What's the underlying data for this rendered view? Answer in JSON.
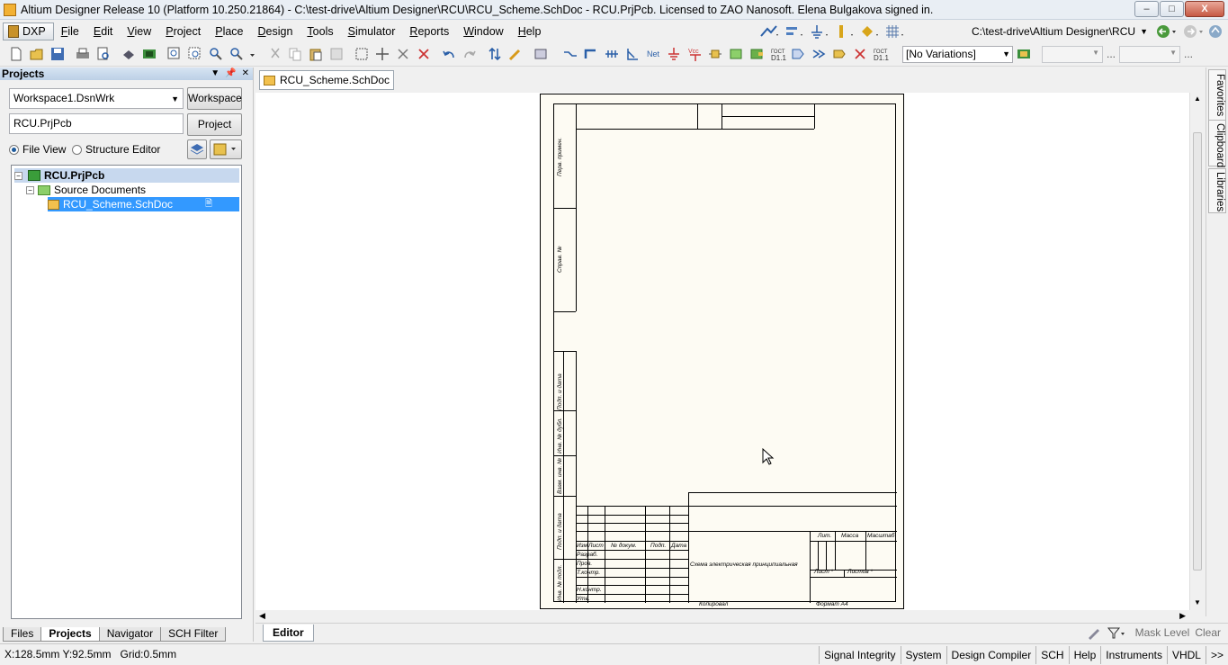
{
  "window": {
    "title": "Altium Designer Release 10 (Platform 10.250.21864) - C:\\test-drive\\Altium Designer\\RCU\\RCU_Scheme.SchDoc - RCU.PrjPcb. Licensed to ZAO Nanosoft. Elena Bulgakova signed in.",
    "minimize": "–",
    "maximize": "□",
    "close": "X"
  },
  "menu": {
    "dxp": "DXP",
    "items": [
      "File",
      "Edit",
      "View",
      "Project",
      "Place",
      "Design",
      "Tools",
      "Simulator",
      "Reports",
      "Window",
      "Help"
    ],
    "path": "C:\\test-drive\\Altium Designer\\RCU"
  },
  "toolbar": {
    "variations": "[No Variations]",
    "ellipsis1": "...",
    "ellipsis2": "..."
  },
  "projects_panel": {
    "title": "Projects",
    "workspace_value": "Workspace1.DsnWrk",
    "workspace_button": "Workspace",
    "project_value": "RCU.PrjPcb",
    "project_button": "Project",
    "file_view_label": "File View",
    "structure_editor_label": "Structure Editor",
    "tree": {
      "project": "RCU.PrjPcb",
      "folder": "Source Documents",
      "document": "RCU_Scheme.SchDoc"
    },
    "tabs": [
      "Files",
      "Projects",
      "Navigator",
      "SCH Filter"
    ]
  },
  "document": {
    "tab_label": "RCU_Scheme.SchDoc",
    "sheet": {
      "side_labels": [
        "Перв. примен.",
        "Справ. №",
        "Подп. и дата",
        "Инв. № дубл.",
        "Взам. инв. №",
        "Подп. и дата",
        "Инв. № подл."
      ],
      "stamp_cols": [
        "Изм.",
        "Лист",
        "№ докум.",
        "Подп.",
        "Дата"
      ],
      "stamp_rows": [
        "Разраб.",
        "Пров.",
        "Т.контр.",
        "Н.контр.",
        "Утв."
      ],
      "title": "Схема электрическая принципиальная",
      "lit": "Лит.",
      "mass": "Масса",
      "scale": "Масштаб",
      "sheet_label": "Лист *",
      "sheets_label": "Листов *",
      "copied": "Копировал",
      "format": "Формат  A4"
    }
  },
  "side_tabs": [
    "Favorites",
    "Clipboard",
    "Libraries"
  ],
  "editor_bar": {
    "tab": "Editor",
    "mask_level": "Mask Level",
    "clear": "Clear"
  },
  "status": {
    "coords": "X:128.5mm Y:92.5mm",
    "grid": "Grid:0.5mm",
    "buttons": [
      "Signal Integrity",
      "System",
      "Design Compiler",
      "SCH",
      "Help",
      "Instruments",
      "VHDL",
      ">>"
    ]
  }
}
